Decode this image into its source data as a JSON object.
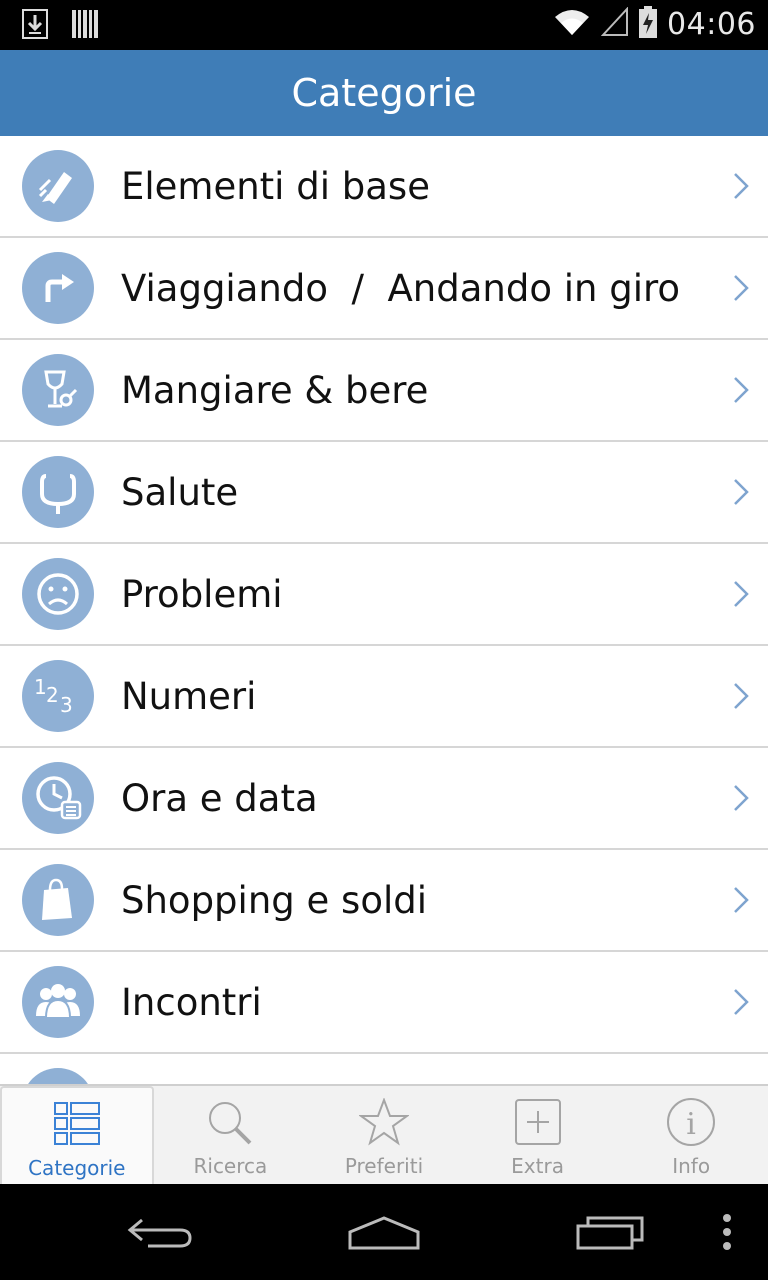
{
  "status_bar": {
    "time": "04:06",
    "icons": [
      "download-icon",
      "barcode-icon",
      "wifi-icon",
      "signal-icon",
      "battery-charging-icon"
    ]
  },
  "header": {
    "title": "Categorie"
  },
  "categories": [
    {
      "label": "Elementi di base",
      "icon": "pencil-icon"
    },
    {
      "label": "Viaggiando  /  Andando in giro",
      "icon": "turn-right-arrow-icon"
    },
    {
      "label": "Mangiare & bere",
      "icon": "glass-and-fork-icon"
    },
    {
      "label": "Salute",
      "icon": "stethoscope-icon"
    },
    {
      "label": "Problemi",
      "icon": "sad-face-icon"
    },
    {
      "label": "Numeri",
      "icon": "numbers-icon"
    },
    {
      "label": "Ora e data",
      "icon": "clock-calendar-icon"
    },
    {
      "label": "Shopping e soldi",
      "icon": "shopping-bag-icon"
    },
    {
      "label": "Incontri",
      "icon": "people-icon"
    }
  ],
  "tabs": [
    {
      "label": "Categorie",
      "icon": "categories-list-icon",
      "active": true
    },
    {
      "label": "Ricerca",
      "icon": "search-icon",
      "active": false
    },
    {
      "label": "Preferiti",
      "icon": "star-icon",
      "active": false
    },
    {
      "label": "Extra",
      "icon": "plus-box-icon",
      "active": false
    },
    {
      "label": "Info",
      "icon": "info-icon",
      "active": false
    }
  ],
  "nav_bar": {
    "buttons": [
      "back-icon",
      "home-icon",
      "recent-apps-icon",
      "overflow-menu-icon"
    ]
  },
  "colors": {
    "header_bg": "#3f7db7",
    "icon_circle": "#8fb0d5",
    "active_tab": "#2f74c4",
    "inactive_tab": "#9a9a9a"
  }
}
